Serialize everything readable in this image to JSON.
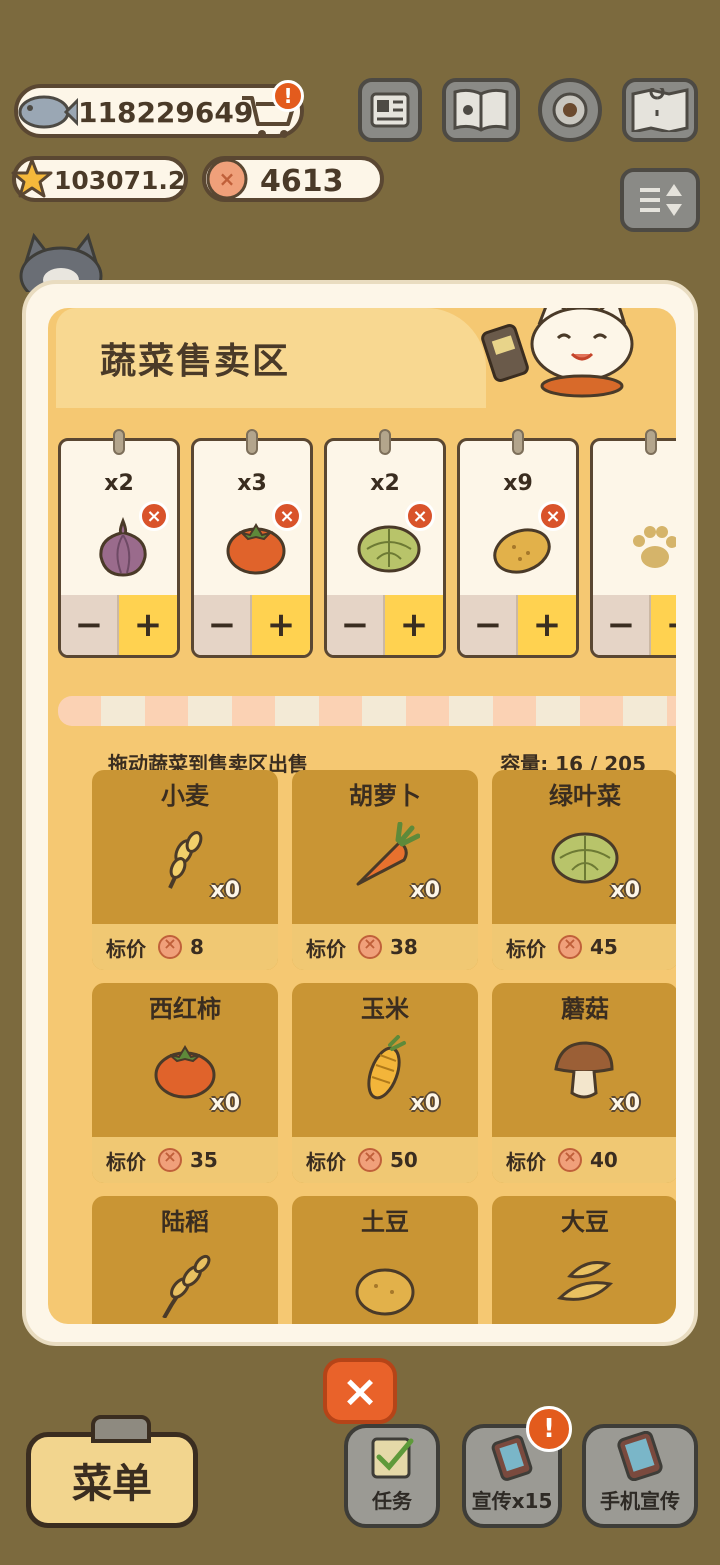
{
  "hud": {
    "fish_count": "118229649",
    "stars": "103071.2",
    "coins": "4613",
    "cart_alert": "!"
  },
  "panel": {
    "title": "蔬菜售卖区",
    "hint": "拖动蔬菜到售卖区出售",
    "capacity_label": "容量: 16 / 205"
  },
  "slots": [
    {
      "qty": "x2",
      "item": "onion-icon"
    },
    {
      "qty": "x3",
      "item": "tomato-icon"
    },
    {
      "qty": "x2",
      "item": "cabbage-icon"
    },
    {
      "qty": "x9",
      "item": "potato-icon"
    },
    {
      "qty": "",
      "item": "paw-icon"
    }
  ],
  "slot_controls": {
    "minus": "−",
    "plus": "+",
    "remove": "×"
  },
  "veggies": [
    {
      "name": "小麦",
      "count": "x0",
      "price_label": "标价",
      "price": "8",
      "icon": "wheat-icon"
    },
    {
      "name": "胡萝卜",
      "count": "x0",
      "price_label": "标价",
      "price": "38",
      "icon": "carrot-icon"
    },
    {
      "name": "绿叶菜",
      "count": "x0",
      "price_label": "标价",
      "price": "45",
      "icon": "cabbage-icon"
    },
    {
      "name": "西红柿",
      "count": "x0",
      "price_label": "标价",
      "price": "35",
      "icon": "tomato-icon"
    },
    {
      "name": "玉米",
      "count": "x0",
      "price_label": "标价",
      "price": "50",
      "icon": "corn-icon"
    },
    {
      "name": "蘑菇",
      "count": "x0",
      "price_label": "标价",
      "price": "40",
      "icon": "mushroom-icon"
    },
    {
      "name": "陆稻",
      "icon": "rice-icon"
    },
    {
      "name": "土豆",
      "icon": "potato-icon"
    },
    {
      "name": "大豆",
      "icon": "soybean-icon"
    }
  ],
  "bottom": {
    "close": "×",
    "menu": "菜单",
    "tasks": "任务",
    "promo": "宣传x15",
    "promo_alert": "!",
    "phone_promo": "手机宣传"
  },
  "colors": {
    "background": "#7c6a3e",
    "panel": "#fdf6e8",
    "inner": "#f5c872",
    "card": "#c99534",
    "accent_plus": "#ffd250",
    "close": "#e9622a"
  }
}
